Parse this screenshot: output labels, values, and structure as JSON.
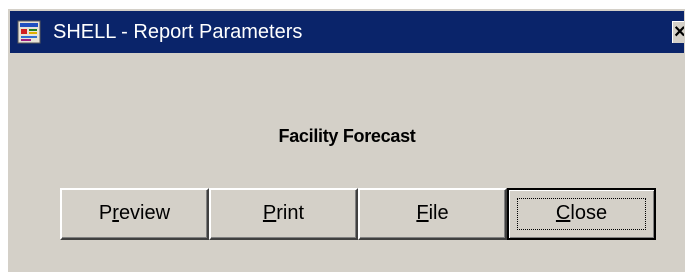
{
  "window": {
    "title": "SHELL - Report Parameters",
    "icon": "report-app-icon",
    "close_glyph": "×"
  },
  "report": {
    "heading": "Facility Forecast"
  },
  "buttons": {
    "preview": {
      "pre": "P",
      "mnemonic": "r",
      "post": "eview"
    },
    "print": {
      "pre": "",
      "mnemonic": "P",
      "post": "rint"
    },
    "file": {
      "pre": "",
      "mnemonic": "F",
      "post": "ile"
    },
    "close": {
      "pre": "",
      "mnemonic": "C",
      "post": "lose",
      "default": true
    }
  },
  "colors": {
    "titlebar": "#0a246a",
    "face": "#d4d0c8"
  }
}
